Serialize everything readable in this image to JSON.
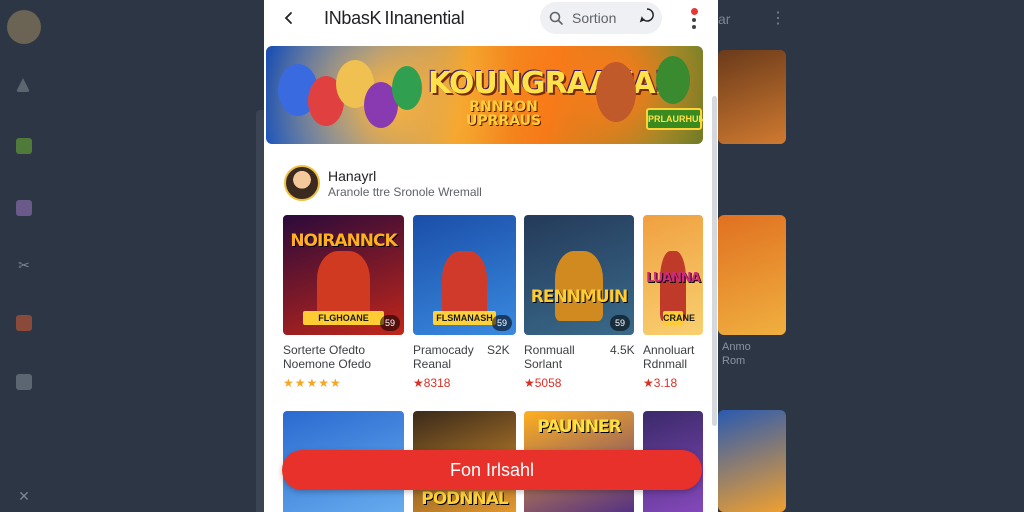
{
  "app": {
    "title": "INbasK IInanential",
    "search_label": "Sortion"
  },
  "background": {
    "right_label": "ar",
    "side_thumbs": [
      {
        "label": "Anmo"
      },
      {
        "label": "Rom"
      }
    ]
  },
  "hero": {
    "title": "KOUNGRAAUAL",
    "subtitle_line1": "RNNRON",
    "subtitle_line2": "UPRRAUS",
    "badge": "PRLAURHUNE"
  },
  "developer": {
    "name": "Hanayrl",
    "subtitle": "Aranole ttre Sronole Wremall"
  },
  "apps": [
    {
      "thumb_title": "NOIRANNCK",
      "thumb_banner": "FLGHOANE",
      "count": "59",
      "line1": "Sorterte Ofedto",
      "line2": "Noemone Ofedo",
      "meta": "",
      "rating": "★★★★★",
      "rating_is_stars": true,
      "colors": {
        "bg1": "#2a0a3a",
        "bg2": "#c2261a",
        "title": "#ffb020",
        "figure": "#d03a20",
        "banner": "#ffcc33"
      }
    },
    {
      "thumb_title": "",
      "thumb_banner": "FLSMANASH",
      "count": "59",
      "line1": "Pramocady",
      "line2": "Reanal",
      "meta": "S2K",
      "rating": "★8318",
      "rating_is_stars": false,
      "colors": {
        "bg1": "#1a4ea8",
        "bg2": "#3a8ae0",
        "title": "#ffd23a",
        "figure": "#d03a2a",
        "banner": "#ffd23a"
      }
    },
    {
      "thumb_title": "RENNMUIN",
      "thumb_banner": "",
      "count": "59",
      "line1": "Ronmuall",
      "line2": "Sorlant",
      "meta": "4.5K",
      "rating": "★5058",
      "rating_is_stars": false,
      "colors": {
        "bg1": "#243a5a",
        "bg2": "#3a6a8a",
        "title": "#ffcc33",
        "figure": "#d08a20",
        "banner": "#ffcc33"
      }
    },
    {
      "thumb_title": "LUANNA",
      "thumb_banner": "CRANE",
      "count": "",
      "line1": "Annoluart",
      "line2": "Rdnmall",
      "meta": "",
      "rating": "★3.18",
      "rating_is_stars": false,
      "colors": {
        "bg1": "#f0a040",
        "bg2": "#f8d070",
        "title": "#d02a80",
        "figure": "#c03a2a",
        "banner": "#ffcc33"
      }
    }
  ],
  "apps_row2": [
    {
      "thumb_title": "",
      "colors": {
        "bg1": "#2a6ad0",
        "bg2": "#6ab0f0",
        "title": "#ffd23a"
      }
    },
    {
      "thumb_title": "PODNNAL",
      "colors": {
        "bg1": "#3a2a1a",
        "bg2": "#f0a030",
        "title": "#ffd23a"
      }
    },
    {
      "thumb_title": "PAUNNER",
      "colors": {
        "bg1": "#ffb020",
        "bg2": "#4a2a8a",
        "title": "#ffe040"
      }
    },
    {
      "thumb_title": "",
      "colors": {
        "bg1": "#3a2a6a",
        "bg2": "#8a4ac0",
        "title": "#ffe040"
      }
    }
  ],
  "cta": {
    "label": "Fon Irlsahl"
  }
}
